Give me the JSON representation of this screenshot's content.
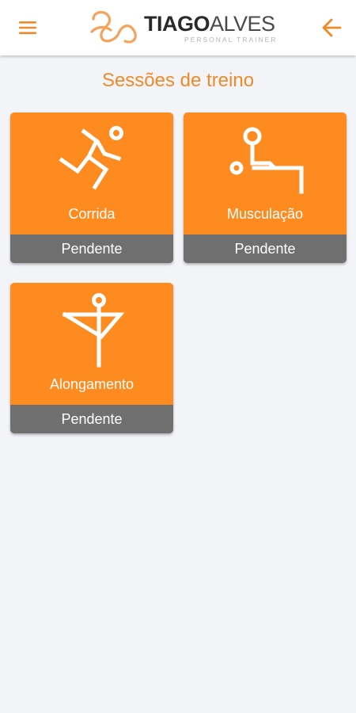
{
  "header": {
    "menu_icon": "hamburger-menu-icon",
    "back_icon": "arrow-left-icon",
    "logo": {
      "name_first": "TIAGO",
      "name_last": "ALVES",
      "subtitle": "PERSONAL TRAINER"
    }
  },
  "page": {
    "title": "Sessões de treino"
  },
  "sessions": [
    {
      "label": "Corrida",
      "status": "Pendente",
      "icon": "running-icon"
    },
    {
      "label": "Musculação",
      "status": "Pendente",
      "icon": "weightlifting-icon"
    },
    {
      "label": "Alongamento",
      "status": "Pendente",
      "icon": "stretching-icon"
    }
  ],
  "colors": {
    "accent": "#f08a28",
    "card": "#fd8b20",
    "status_bar": "#6f6f6f",
    "background": "#f3f4f8"
  }
}
